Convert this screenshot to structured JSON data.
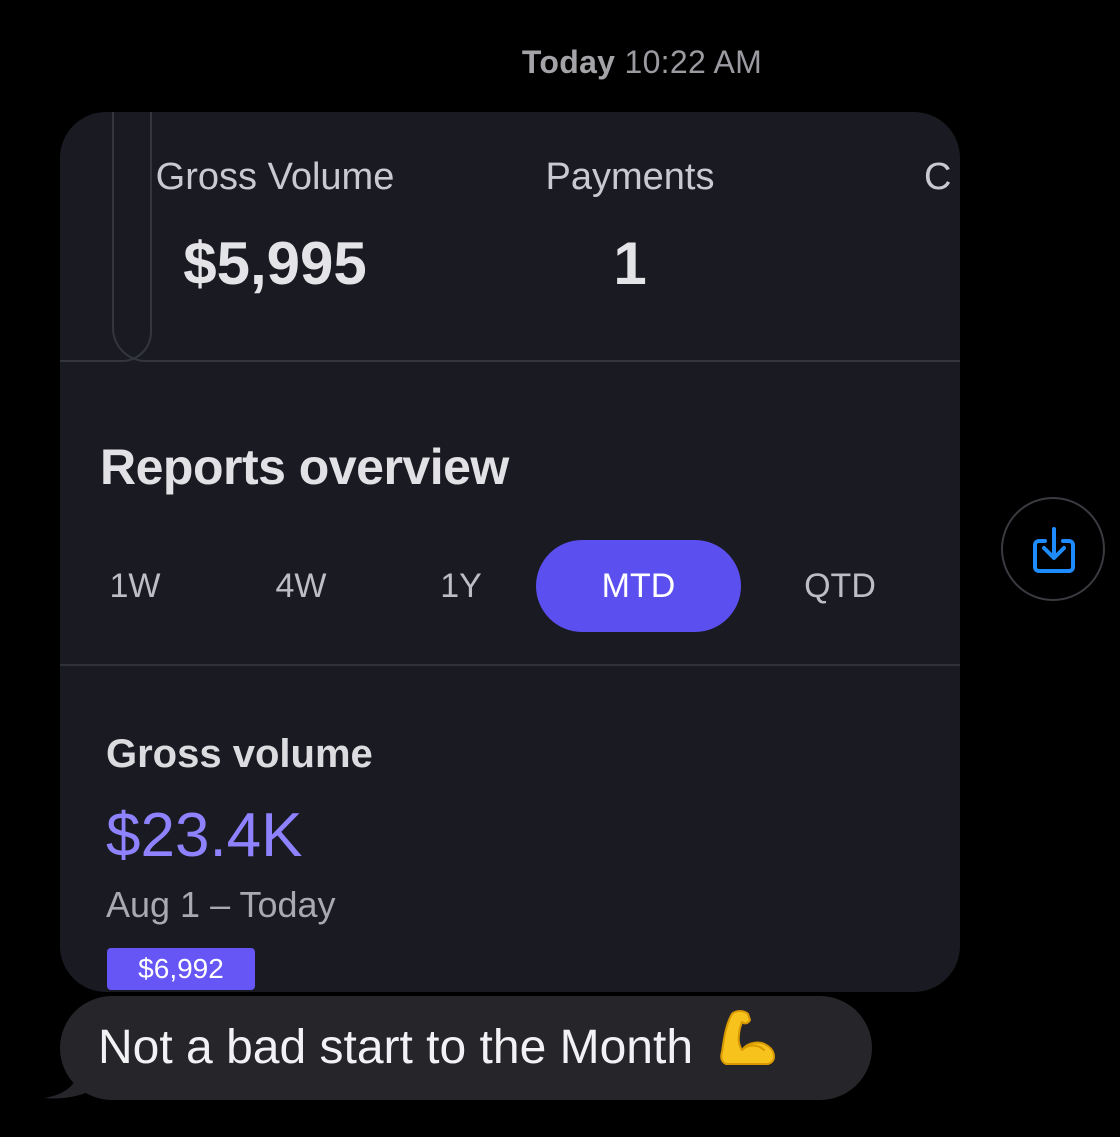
{
  "header": {
    "day": "Today",
    "time": "10:22 AM"
  },
  "screenshot": {
    "stats": [
      {
        "label": "Gross Volume",
        "value": "$5,995"
      },
      {
        "label": "Payments",
        "value": "1"
      },
      {
        "label": "C",
        "value": ""
      }
    ],
    "reports_title": "Reports overview",
    "tabs": [
      {
        "label": "1W",
        "active": false
      },
      {
        "label": "4W",
        "active": false
      },
      {
        "label": "1Y",
        "active": false
      },
      {
        "label": "MTD",
        "active": true
      },
      {
        "label": "QTD",
        "active": false
      }
    ],
    "gross_volume": {
      "label": "Gross volume",
      "value": "$23.4K",
      "range": "Aug 1 – Today",
      "badge": "$6,992"
    }
  },
  "actions": {
    "save_icon": "save-download-icon"
  },
  "message": {
    "text": "Not a bad start to the Month",
    "emoji": "flexed-biceps"
  },
  "colors": {
    "background": "#000000",
    "card": "#1a1b22",
    "accent": "#5b4ff0",
    "accent_text": "#8f82ff",
    "message_bubble": "#26262a",
    "save_icon": "#1e8cff"
  }
}
